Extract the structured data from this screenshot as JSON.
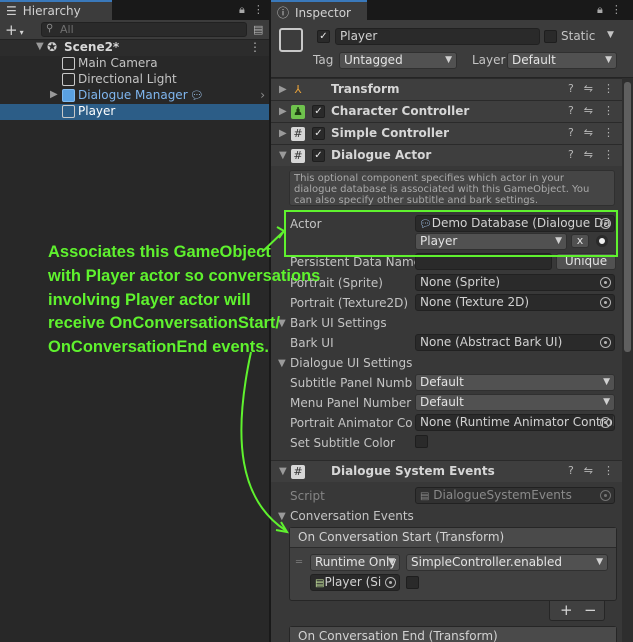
{
  "hierarchy": {
    "tab_label": "Hierarchy",
    "search_placeholder": "All",
    "items": [
      {
        "label": "Scene2*"
      },
      {
        "label": "Main Camera"
      },
      {
        "label": "Directional Light"
      },
      {
        "label": "Dialogue Manager"
      },
      {
        "label": "Player"
      }
    ]
  },
  "inspector": {
    "tab_label": "Inspector",
    "object_name": "Player",
    "static_label": "Static",
    "tag_label": "Tag",
    "tag_value": "Untagged",
    "layer_label": "Layer",
    "layer_value": "Default",
    "components": {
      "transform": "Transform",
      "character_controller": "Character Controller",
      "simple_controller": "Simple Controller",
      "dialogue_actor": "Dialogue Actor",
      "dialogue_system_events": "Dialogue System Events"
    },
    "help_text": "This optional component specifies which actor in your dialogue database is associated with this GameObject. You can also specify other subtitle and bark settings.",
    "actor_label": "Actor",
    "actor_database": "Demo Database (Dialogue Da",
    "actor_value": "Player",
    "clear_label": "x",
    "persistent_label": "Persistent Data Name",
    "unique_label": "Unique",
    "portrait_sprite_label": "Portrait (Sprite)",
    "portrait_sprite_value": "None (Sprite)",
    "portrait_tex_label": "Portrait (Texture2D)",
    "portrait_tex_value": "None (Texture 2D)",
    "bark_settings_label": "Bark UI Settings",
    "bark_ui_label": "Bark UI",
    "bark_ui_value": "None (Abstract Bark UI)",
    "dialogue_ui_settings_label": "Dialogue UI Settings",
    "subtitle_panel_label": "Subtitle Panel Number",
    "subtitle_panel_value": "Default",
    "menu_panel_label": "Menu Panel Number",
    "menu_panel_value": "Default",
    "portrait_anim_label": "Portrait Animator Contr",
    "portrait_anim_value": "None (Runtime Animator Controll",
    "set_subtitle_color_label": "Set Subtitle Color",
    "script_label": "Script",
    "script_value": "DialogueSystemEvents",
    "conversation_events_label": "Conversation Events",
    "on_start_label": "On Conversation Start (Transform)",
    "runtime_value": "Runtime Only",
    "function_value": "SimpleController.enabled",
    "target_value": "Player (Si",
    "on_end_label": "On Conversation End (Transform)",
    "plus": "+",
    "minus": "−"
  },
  "annotation": {
    "lines": [
      "Associates this GameObject",
      "with Player actor so conversations",
      "involving Player actor will",
      "receive OnConversationStart/",
      "OnConversationEnd events."
    ],
    "color": "#5ff22e"
  }
}
